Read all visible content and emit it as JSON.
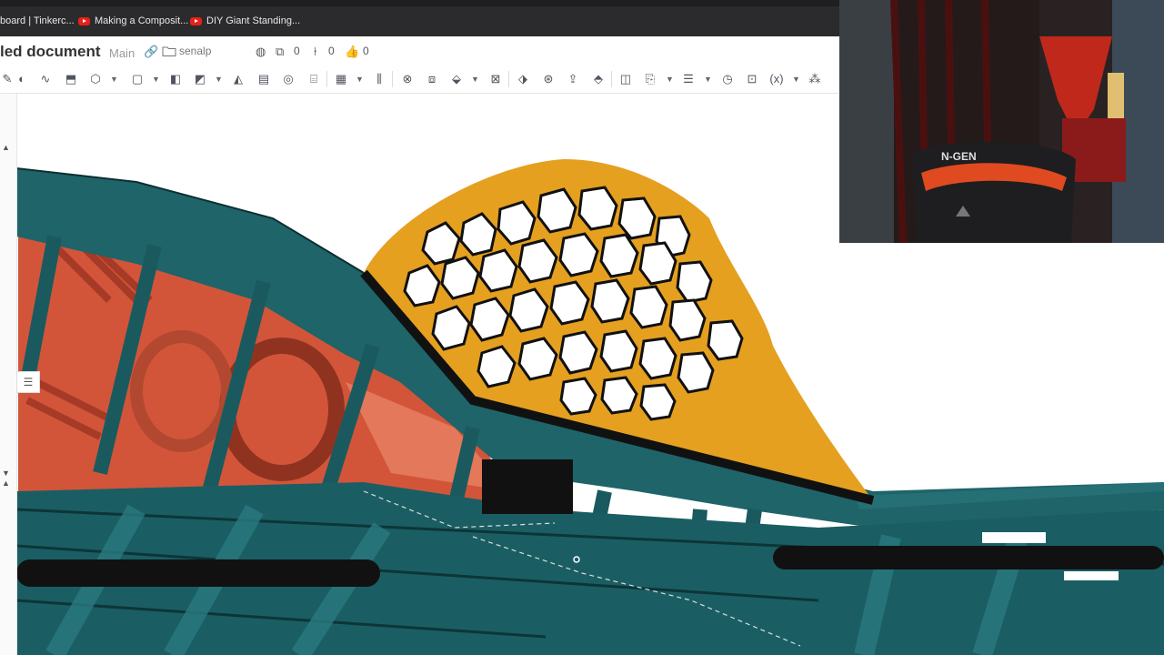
{
  "bookmarks": [
    {
      "label": "board | Tinkerc...",
      "icon": "tinkercad-icon"
    },
    {
      "label": "Making a Composit...",
      "icon": "youtube-icon"
    },
    {
      "label": "DIY Giant Standing...",
      "icon": "youtube-icon"
    }
  ],
  "document": {
    "title": "led document",
    "branch": "Main",
    "folder": "senalp",
    "versions_count": "0",
    "branches_count": "0",
    "likes_count": "0"
  },
  "toolbar": {
    "icons": [
      "sketch-icon",
      "extrude-icon",
      "revolve-icon",
      "sweep-icon",
      "loft-icon",
      "thicken-icon",
      "fillet-icon",
      "chamfer-icon",
      "draft-icon",
      "rib-icon",
      "shell-icon",
      "hole-icon",
      "boolean-icon",
      "split-icon",
      "transform-icon",
      "pattern-icon",
      "mirror-icon",
      "delete-part-icon",
      "plane-icon",
      "mate-connector-icon",
      "helix-icon",
      "fit-spline-icon",
      "variable-icon",
      "variable-studio-icon",
      "measure-icon",
      "custom-feature-icon"
    ],
    "variable_label": "(x)"
  },
  "viewport": {
    "colors": {
      "teal": "#1e6469",
      "orange": "#d2553a",
      "gold": "#e5a020",
      "black": "#111111"
    }
  },
  "webcam": {
    "chair_brand": "N-GEN"
  }
}
